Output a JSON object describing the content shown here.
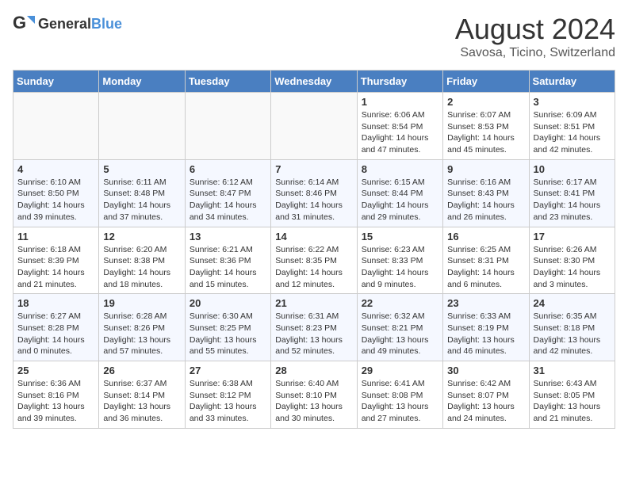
{
  "header": {
    "logo_general": "General",
    "logo_blue": "Blue",
    "month_title": "August 2024",
    "location": "Savosa, Ticino, Switzerland"
  },
  "calendar": {
    "days_of_week": [
      "Sunday",
      "Monday",
      "Tuesday",
      "Wednesday",
      "Thursday",
      "Friday",
      "Saturday"
    ],
    "weeks": [
      [
        {
          "day": "",
          "info": ""
        },
        {
          "day": "",
          "info": ""
        },
        {
          "day": "",
          "info": ""
        },
        {
          "day": "",
          "info": ""
        },
        {
          "day": "1",
          "info": "Sunrise: 6:06 AM\nSunset: 8:54 PM\nDaylight: 14 hours and 47 minutes."
        },
        {
          "day": "2",
          "info": "Sunrise: 6:07 AM\nSunset: 8:53 PM\nDaylight: 14 hours and 45 minutes."
        },
        {
          "day": "3",
          "info": "Sunrise: 6:09 AM\nSunset: 8:51 PM\nDaylight: 14 hours and 42 minutes."
        }
      ],
      [
        {
          "day": "4",
          "info": "Sunrise: 6:10 AM\nSunset: 8:50 PM\nDaylight: 14 hours and 39 minutes."
        },
        {
          "day": "5",
          "info": "Sunrise: 6:11 AM\nSunset: 8:48 PM\nDaylight: 14 hours and 37 minutes."
        },
        {
          "day": "6",
          "info": "Sunrise: 6:12 AM\nSunset: 8:47 PM\nDaylight: 14 hours and 34 minutes."
        },
        {
          "day": "7",
          "info": "Sunrise: 6:14 AM\nSunset: 8:46 PM\nDaylight: 14 hours and 31 minutes."
        },
        {
          "day": "8",
          "info": "Sunrise: 6:15 AM\nSunset: 8:44 PM\nDaylight: 14 hours and 29 minutes."
        },
        {
          "day": "9",
          "info": "Sunrise: 6:16 AM\nSunset: 8:43 PM\nDaylight: 14 hours and 26 minutes."
        },
        {
          "day": "10",
          "info": "Sunrise: 6:17 AM\nSunset: 8:41 PM\nDaylight: 14 hours and 23 minutes."
        }
      ],
      [
        {
          "day": "11",
          "info": "Sunrise: 6:18 AM\nSunset: 8:39 PM\nDaylight: 14 hours and 21 minutes."
        },
        {
          "day": "12",
          "info": "Sunrise: 6:20 AM\nSunset: 8:38 PM\nDaylight: 14 hours and 18 minutes."
        },
        {
          "day": "13",
          "info": "Sunrise: 6:21 AM\nSunset: 8:36 PM\nDaylight: 14 hours and 15 minutes."
        },
        {
          "day": "14",
          "info": "Sunrise: 6:22 AM\nSunset: 8:35 PM\nDaylight: 14 hours and 12 minutes."
        },
        {
          "day": "15",
          "info": "Sunrise: 6:23 AM\nSunset: 8:33 PM\nDaylight: 14 hours and 9 minutes."
        },
        {
          "day": "16",
          "info": "Sunrise: 6:25 AM\nSunset: 8:31 PM\nDaylight: 14 hours and 6 minutes."
        },
        {
          "day": "17",
          "info": "Sunrise: 6:26 AM\nSunset: 8:30 PM\nDaylight: 14 hours and 3 minutes."
        }
      ],
      [
        {
          "day": "18",
          "info": "Sunrise: 6:27 AM\nSunset: 8:28 PM\nDaylight: 14 hours and 0 minutes."
        },
        {
          "day": "19",
          "info": "Sunrise: 6:28 AM\nSunset: 8:26 PM\nDaylight: 13 hours and 57 minutes."
        },
        {
          "day": "20",
          "info": "Sunrise: 6:30 AM\nSunset: 8:25 PM\nDaylight: 13 hours and 55 minutes."
        },
        {
          "day": "21",
          "info": "Sunrise: 6:31 AM\nSunset: 8:23 PM\nDaylight: 13 hours and 52 minutes."
        },
        {
          "day": "22",
          "info": "Sunrise: 6:32 AM\nSunset: 8:21 PM\nDaylight: 13 hours and 49 minutes."
        },
        {
          "day": "23",
          "info": "Sunrise: 6:33 AM\nSunset: 8:19 PM\nDaylight: 13 hours and 46 minutes."
        },
        {
          "day": "24",
          "info": "Sunrise: 6:35 AM\nSunset: 8:18 PM\nDaylight: 13 hours and 42 minutes."
        }
      ],
      [
        {
          "day": "25",
          "info": "Sunrise: 6:36 AM\nSunset: 8:16 PM\nDaylight: 13 hours and 39 minutes."
        },
        {
          "day": "26",
          "info": "Sunrise: 6:37 AM\nSunset: 8:14 PM\nDaylight: 13 hours and 36 minutes."
        },
        {
          "day": "27",
          "info": "Sunrise: 6:38 AM\nSunset: 8:12 PM\nDaylight: 13 hours and 33 minutes."
        },
        {
          "day": "28",
          "info": "Sunrise: 6:40 AM\nSunset: 8:10 PM\nDaylight: 13 hours and 30 minutes."
        },
        {
          "day": "29",
          "info": "Sunrise: 6:41 AM\nSunset: 8:08 PM\nDaylight: 13 hours and 27 minutes."
        },
        {
          "day": "30",
          "info": "Sunrise: 6:42 AM\nSunset: 8:07 PM\nDaylight: 13 hours and 24 minutes."
        },
        {
          "day": "31",
          "info": "Sunrise: 6:43 AM\nSunset: 8:05 PM\nDaylight: 13 hours and 21 minutes."
        }
      ]
    ]
  }
}
